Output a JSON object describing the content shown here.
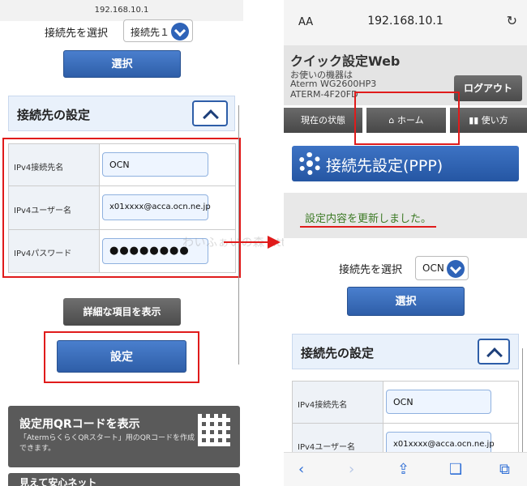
{
  "left": {
    "url": "192.168.10.1",
    "select_label": "接続先を選択",
    "select_value": "接続先１",
    "select_button": "選択",
    "section_title": "接続先の設定",
    "fields": [
      {
        "label": "IPv4接続先名",
        "value": "OCN"
      },
      {
        "label": "IPv4ユーザー名",
        "value": "x01xxxx@acca.ocn.ne.jp"
      },
      {
        "label": "IPv4パスワード",
        "value": "●●●●●●●●"
      }
    ],
    "detail_button": "詳細な項目を表示",
    "set_button": "設定",
    "qr_title": "設定用QRコードを表示",
    "qr_desc": "「AtermらくらくQRスタート」用のQRコードを作成できます。",
    "bottom_label": "見えて安心ネット"
  },
  "watermark": "わいふぁいの森  https://wifinomori.com",
  "right": {
    "aa": "AA",
    "url": "192.168.10.1",
    "app_title": "クイック設定Web",
    "device_label": "お使いの機器は",
    "device_model": "Aterm WG2600HP3",
    "device_id": "ATERM-4F20FD",
    "logout_button": "ログアウト",
    "nav": [
      {
        "label": "現在の状態",
        "icon": ""
      },
      {
        "label": "ホーム",
        "icon": "home-icon"
      },
      {
        "label": "使い方",
        "icon": "book-icon"
      }
    ],
    "page_title": "接続先設定(PPP)",
    "message": "設定内容を更新しました。",
    "select_label": "接続先を選択",
    "select_value": "OCN",
    "select_button": "選択",
    "section_title": "接続先の設定",
    "fields": [
      {
        "label": "IPv4接続先名",
        "value": "OCN"
      },
      {
        "label": "IPv4ユーザー名",
        "value": "x01xxxx@acca.ocn.ne.jp"
      }
    ]
  },
  "colors": {
    "accent": "#2e5ea8",
    "highlight": "#e01b1b",
    "message": "#3c7a24"
  }
}
